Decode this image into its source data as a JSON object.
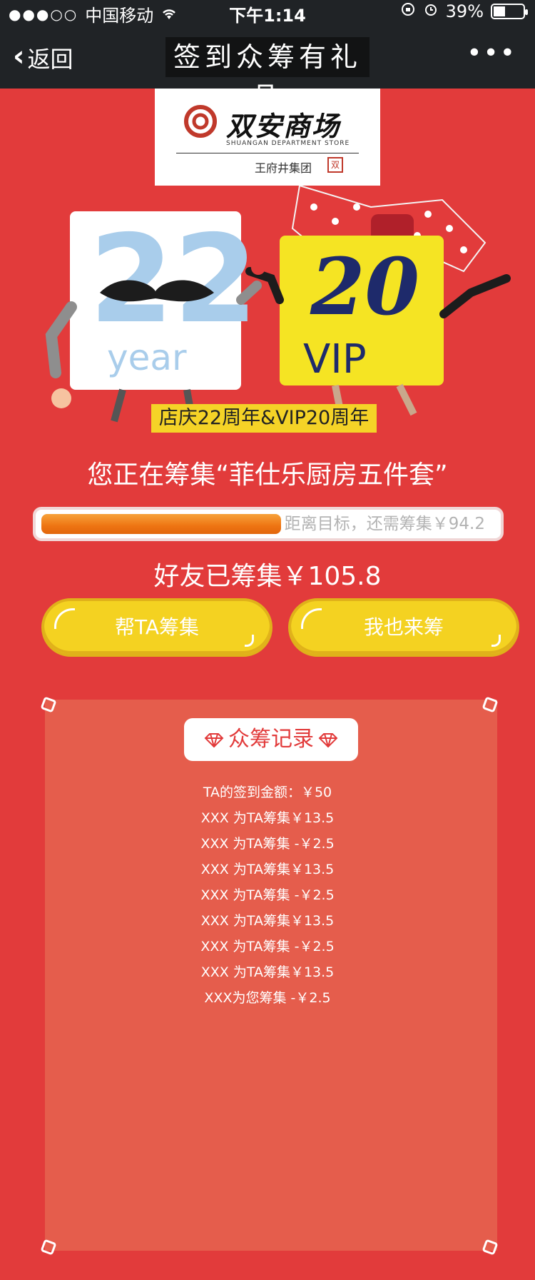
{
  "status_bar": {
    "carrier": "中国移动",
    "time": "下午1:14",
    "battery": "39%",
    "battery_level": 0.39
  },
  "nav": {
    "back_label": "返回",
    "title": "签到众筹有礼品",
    "more_label": "•••"
  },
  "logo": {
    "name_cn": "双安商场",
    "name_en": "SHUANGAN DEPARTMENT STORE",
    "group": "王府井集团"
  },
  "illustration": {
    "number_22": "22",
    "year_text": "year",
    "number_20": "20",
    "vip_text": "VIP",
    "banner": "店庆22周年&VIP20周年"
  },
  "headline": "您正在筹集“菲仕乐厨房五件套”",
  "progress": {
    "remaining_text": "距离目标，还需筹集￥94.2",
    "fraction": 0.529
  },
  "raised_text": "好友已筹集￥105.8",
  "buttons": {
    "help": "帮TA筹集",
    "join": "我也来筹"
  },
  "records": {
    "title": "众筹记录",
    "rows": [
      "TA的签到金额：￥50",
      "XXX 为TA筹集￥13.5",
      "XXX 为TA筹集 -￥2.5",
      "XXX 为TA筹集￥13.5",
      "XXX 为TA筹集 -￥2.5",
      "XXX 为TA筹集￥13.5",
      "XXX 为TA筹集 -￥2.5",
      "XXX 为TA筹集￥13.5",
      "XXX为您筹集 -￥2.5"
    ]
  },
  "colors": {
    "background": "#E23B3B",
    "panel": "#E55D4C",
    "button": "#F4D221",
    "progress": "#EE7412",
    "topbar": "#202326"
  }
}
